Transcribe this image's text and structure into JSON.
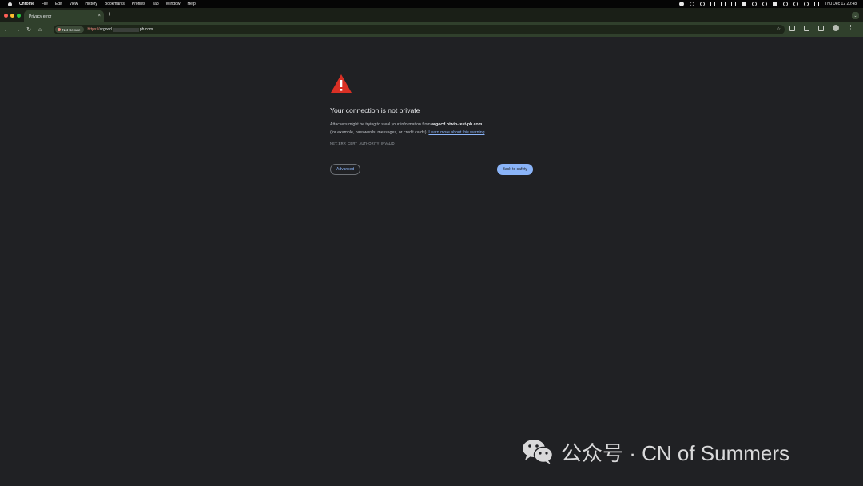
{
  "menubar": {
    "app": "Chrome",
    "items": [
      "File",
      "Edit",
      "View",
      "History",
      "Bookmarks",
      "Profiles",
      "Tab",
      "Window",
      "Help"
    ],
    "clock": "Thu Dec 12 20:48"
  },
  "tab": {
    "title": "Privacy error",
    "close": "×",
    "new_tab": "+"
  },
  "toolbar": {
    "back": "←",
    "forward": "→",
    "reload": "↻",
    "home": "⌂",
    "security_chip": "Not Secure",
    "url": {
      "scheme": "https://",
      "host_start": "argocd",
      "host_end": "ph.com"
    },
    "bookmark": "☆",
    "menu": "⋮"
  },
  "interstitial": {
    "icon": "warning-triangle-icon",
    "heading": "Your connection is not private",
    "message_pre": "Attackers might be trying to steal your information from",
    "host": "argocd.hiwin-test-ph.com",
    "message_post": "(for example, passwords, messages, or credit cards).",
    "learn_more": "Learn more about this warning",
    "error_code": "NET::ERR_CERT_AUTHORITY_INVALID",
    "advanced_label": "Advanced",
    "back_label": "Back to safety"
  },
  "watermark": {
    "text": "公众号 · CN of Summers"
  },
  "colors": {
    "page_bg": "#202124",
    "toolbar_bg": "#30402c",
    "warning_red": "#d93025",
    "link_blue": "#8ab4f8",
    "not_secure_red": "#f28b82"
  }
}
